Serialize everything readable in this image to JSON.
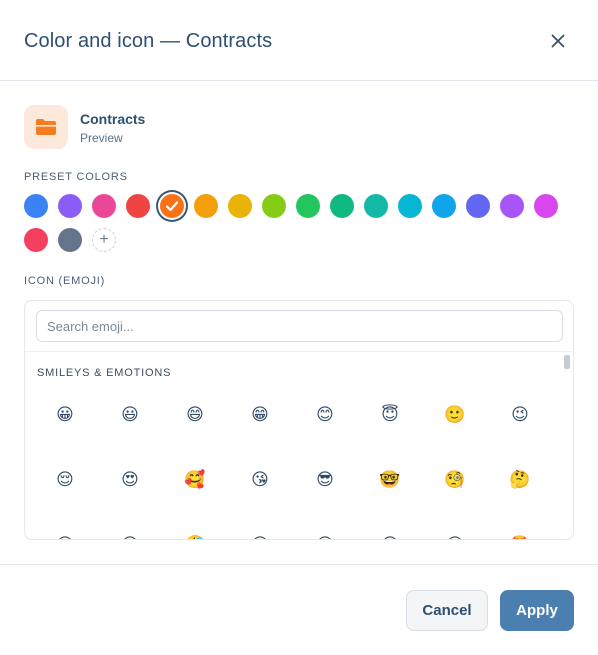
{
  "dialog": {
    "title": "Color and icon — Contracts",
    "close_icon": "close-icon"
  },
  "preview": {
    "icon": "folder-icon",
    "icon_color": "#f57c1f",
    "tile_bg": "#fde9dc",
    "name": "Contracts",
    "subtitle": "Preview"
  },
  "colors": {
    "label": "PRESET COLORS",
    "selected_index": 4,
    "swatches": [
      "#3b82f6",
      "#8b5cf6",
      "#ec4899",
      "#ef4444",
      "#f97316",
      "#f59e0b",
      "#eab308",
      "#84cc16",
      "#22c55e",
      "#10b981",
      "#14b8a6",
      "#06b6d4",
      "#0ea5e9",
      "#6366f1",
      "#a855f7",
      "#d946ef",
      "#f43f5e",
      "#64748b"
    ],
    "add_label": "+"
  },
  "emoji": {
    "label": "ICON (EMOJI)",
    "search_placeholder": "Search emoji...",
    "search_value": "",
    "category": "SMILEYS & EMOTIONS",
    "items": [
      "😀",
      "😃",
      "😄",
      "😁",
      "😊",
      "😇",
      "🙂",
      "😉",
      "😌",
      "😍",
      "🥰",
      "😘",
      "😎",
      "🤓",
      "🧐",
      "🤔",
      "😆",
      "😅",
      "🤣",
      "😂",
      "🙃",
      "😋",
      "😛",
      "🤩"
    ]
  },
  "footer": {
    "cancel_label": "Cancel",
    "apply_label": "Apply"
  }
}
